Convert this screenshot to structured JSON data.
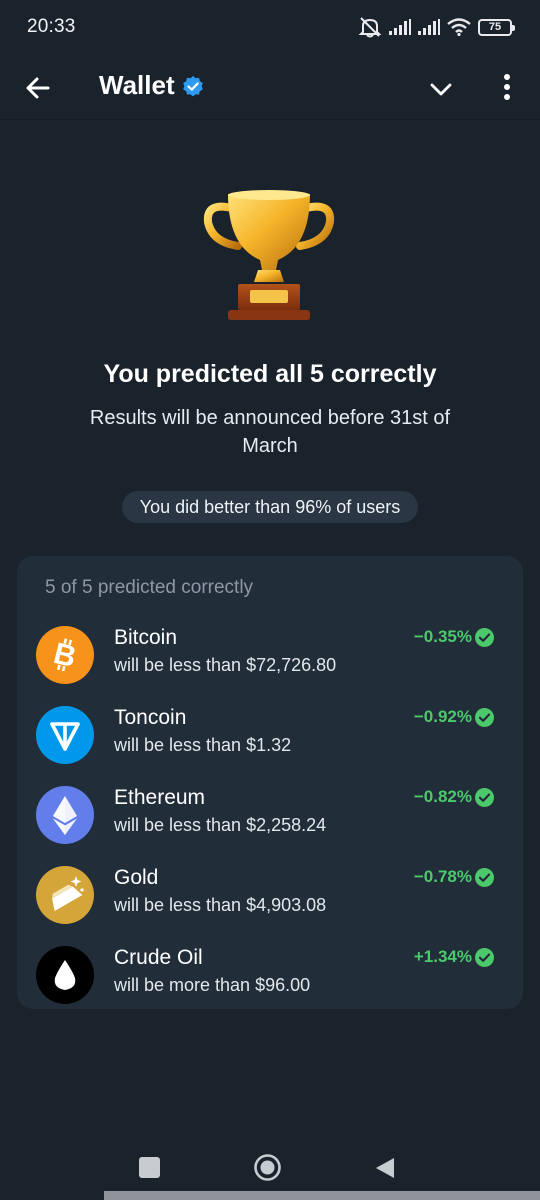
{
  "status_bar": {
    "time": "20:33",
    "battery": "75",
    "icons": [
      "mute-icon",
      "signal-icon",
      "signal-icon",
      "wifi-icon",
      "battery-icon"
    ]
  },
  "header": {
    "title": "Wallet",
    "icons": [
      "back-arrow-icon",
      "verified-icon",
      "chevron-down-icon",
      "more-vertical-icon"
    ]
  },
  "result": {
    "icon": "trophy-icon",
    "headline": "You predicted all 5 correctly",
    "subline": "Results will be announced before 31st of March",
    "badge": "You did better than 96% of users"
  },
  "card": {
    "title": "5 of 5 predicted correctly",
    "predictions": [
      {
        "name": "Bitcoin",
        "desc": "will be less than $72,726.80",
        "change": "−0.35%",
        "icon": "bitcoin-icon"
      },
      {
        "name": "Toncoin",
        "desc": "will be less than $1.32",
        "change": "−0.92%",
        "icon": "toncoin-icon"
      },
      {
        "name": "Ethereum",
        "desc": "will be less than $2,258.24",
        "change": "−0.82%",
        "icon": "ethereum-icon"
      },
      {
        "name": "Gold",
        "desc": "will be less than $4,903.08",
        "change": "−0.78%",
        "icon": "gold-icon"
      },
      {
        "name": "Crude Oil",
        "desc": "will be more than $96.00",
        "change": "+1.34%",
        "icon": "oil-drop-icon"
      }
    ]
  },
  "colors": {
    "background": "#1a222c",
    "card": "#222d3a",
    "positive": "#4cc96b",
    "accent": "#2f9bf0"
  },
  "nav": {
    "icons": [
      "recents-icon",
      "home-icon",
      "back-icon"
    ]
  }
}
